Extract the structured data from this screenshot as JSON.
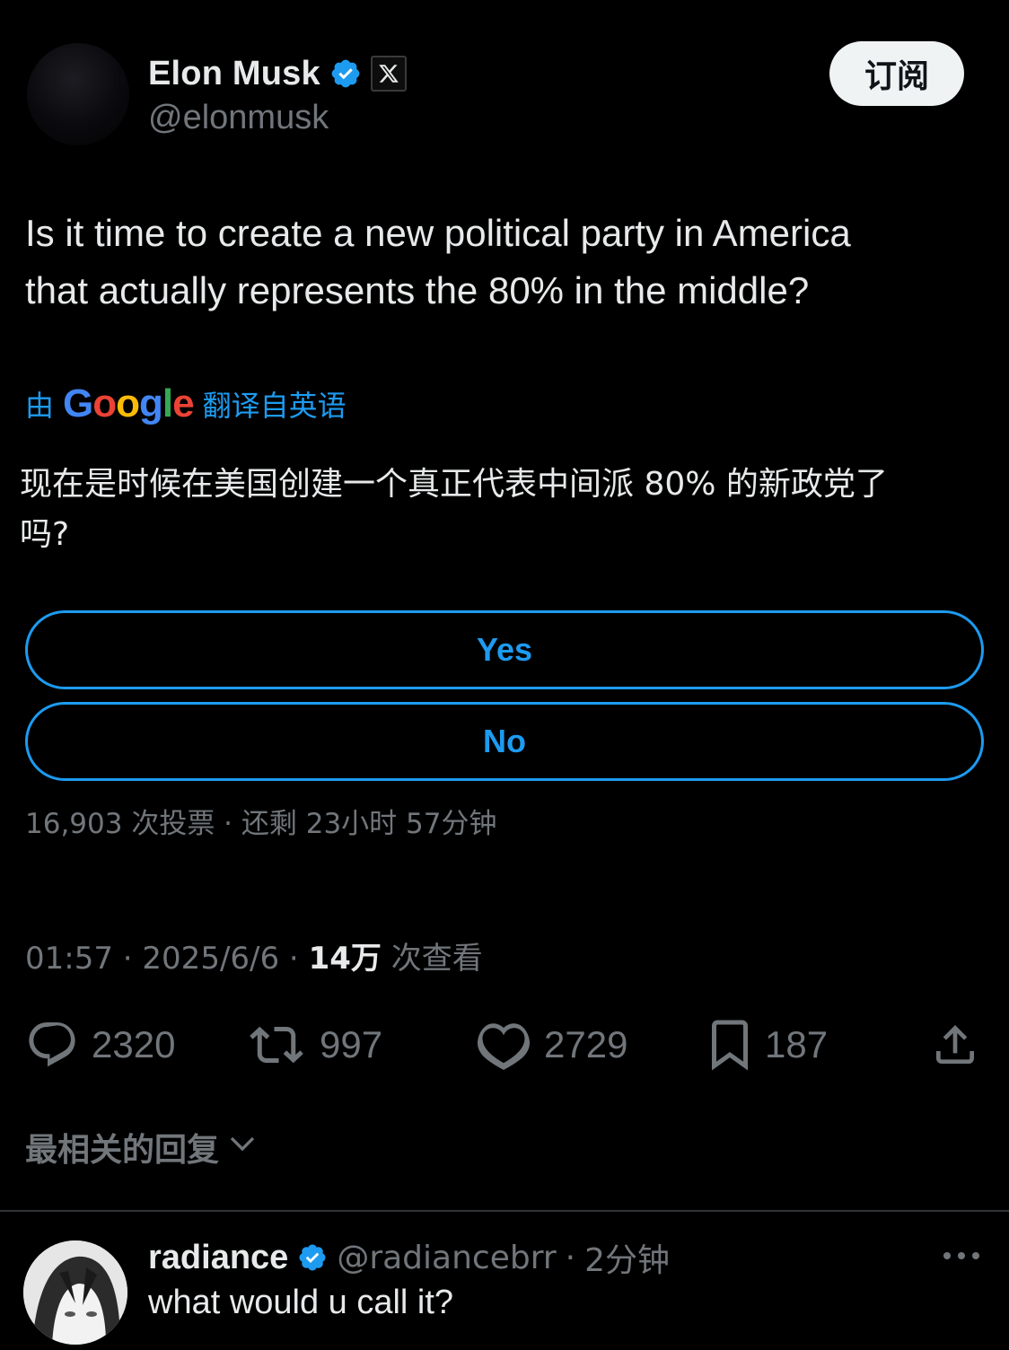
{
  "author": {
    "display_name": "Elon Musk",
    "handle": "@elonmusk",
    "verified_icon": "verified-badge-icon",
    "affiliation_icon": "x-logo-icon"
  },
  "header": {
    "subscribe_label": "订阅"
  },
  "tweet": {
    "text_line1": "Is it time to create a new political party in America",
    "text_line2": "that actually represents the 80% in the middle?",
    "translation": {
      "prefix": "由",
      "provider": "Google",
      "suffix": "翻译自英语",
      "text_line1": "现在是时候在美国创建一个真正代表中间派 80% 的新政党了",
      "text_line2": "吗?"
    }
  },
  "poll": {
    "options": [
      {
        "label": "Yes"
      },
      {
        "label": "No"
      }
    ],
    "meta": "16,903 次投票 · 还剩 23小时 57分钟"
  },
  "timestamp": {
    "time": "01:57",
    "date": "2025/6/6",
    "views_count": "14万",
    "views_label": "次查看"
  },
  "actions": {
    "replies": "2320",
    "reposts": "997",
    "likes": "2729",
    "bookmarks": "187"
  },
  "replies_section": {
    "sort_label": "最相关的回复"
  },
  "reply": {
    "display_name": "radiance",
    "handle": "@radiancebrr",
    "time": "2分钟",
    "text": "what would u call it?"
  },
  "colors": {
    "background": "#000000",
    "accent": "#1d9bf0",
    "text_primary": "#e7e9ea",
    "text_secondary": "#71767b"
  }
}
